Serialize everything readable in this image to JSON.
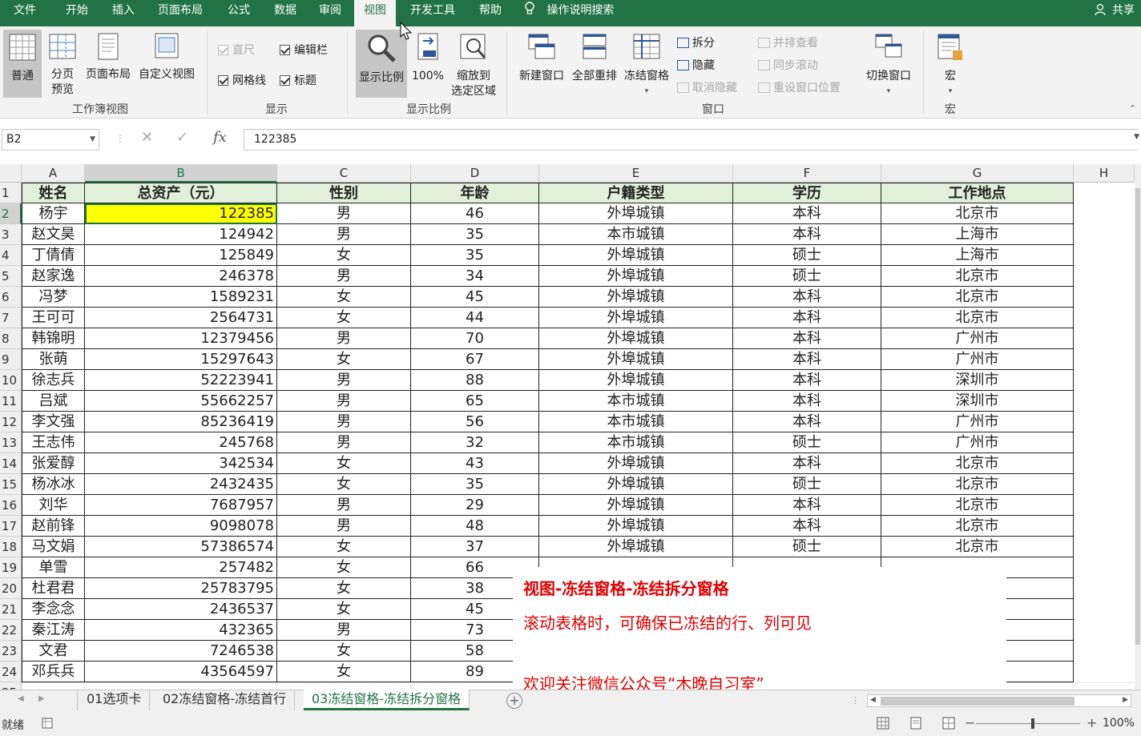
{
  "ribbon_tabs": [
    "文件",
    "开始",
    "插入",
    "页面布局",
    "公式",
    "数据",
    "审阅",
    "视图",
    "开发工具",
    "帮助"
  ],
  "active_tab": "视图",
  "tell_me": "操作说明搜索",
  "share": "共享",
  "ribbon": {
    "workbook_views": {
      "label": "工作簿视图",
      "normal": "普通",
      "page_break_1": "分页",
      "page_break_2": "预览",
      "page_layout": "页面布局",
      "custom_views": "自定义视图"
    },
    "show": {
      "label": "显示",
      "ruler": "直尺",
      "formula_bar": "编辑栏",
      "gridlines": "网格线",
      "headings": "标题"
    },
    "zoom": {
      "label": "显示比例",
      "zoom": "显示比例",
      "hundred": "100%",
      "zoom_sel_1": "缩放到",
      "zoom_sel_2": "选定区域"
    },
    "window": {
      "label": "窗口",
      "new_window": "新建窗口",
      "arrange_all": "全部重排",
      "freeze_panes": "冻结窗格",
      "split": "拆分",
      "hide": "隐藏",
      "unhide": "取消隐藏",
      "side_by_side": "并排查看",
      "sync_scroll": "同步滚动",
      "reset_pos": "重设窗口位置",
      "switch_windows": "切换窗口"
    },
    "macros": {
      "label": "宏",
      "macros": "宏"
    }
  },
  "formula_bar": {
    "name_box": "B2",
    "value": "122385"
  },
  "columns": [
    "A",
    "B",
    "C",
    "D",
    "E",
    "F",
    "G",
    "H"
  ],
  "header_row": [
    "姓名",
    "总资产（元）",
    "性别",
    "年龄",
    "户籍类型",
    "学历",
    "工作地点"
  ],
  "rows": [
    [
      "杨宇",
      "122385",
      "男",
      "46",
      "外埠城镇",
      "本科",
      "北京市"
    ],
    [
      "赵文昊",
      "124942",
      "男",
      "35",
      "本市城镇",
      "本科",
      "上海市"
    ],
    [
      "丁倩倩",
      "125849",
      "女",
      "35",
      "外埠城镇",
      "硕士",
      "上海市"
    ],
    [
      "赵家逸",
      "246378",
      "男",
      "34",
      "外埠城镇",
      "硕士",
      "北京市"
    ],
    [
      "冯梦",
      "1589231",
      "女",
      "45",
      "外埠城镇",
      "本科",
      "北京市"
    ],
    [
      "王可可",
      "2564731",
      "女",
      "44",
      "外埠城镇",
      "本科",
      "北京市"
    ],
    [
      "韩锦明",
      "12379456",
      "男",
      "70",
      "外埠城镇",
      "本科",
      "广州市"
    ],
    [
      "张萌",
      "15297643",
      "女",
      "67",
      "外埠城镇",
      "本科",
      "广州市"
    ],
    [
      "徐志兵",
      "52223941",
      "男",
      "88",
      "外埠城镇",
      "本科",
      "深圳市"
    ],
    [
      "吕斌",
      "55662257",
      "男",
      "65",
      "本市城镇",
      "本科",
      "深圳市"
    ],
    [
      "李文强",
      "85236419",
      "男",
      "56",
      "本市城镇",
      "本科",
      "广州市"
    ],
    [
      "王志伟",
      "245768",
      "男",
      "32",
      "本市城镇",
      "硕士",
      "广州市"
    ],
    [
      "张爱醇",
      "342534",
      "女",
      "43",
      "外埠城镇",
      "本科",
      "北京市"
    ],
    [
      "杨冰冰",
      "2432435",
      "女",
      "35",
      "外埠城镇",
      "硕士",
      "北京市"
    ],
    [
      "刘华",
      "7687957",
      "男",
      "29",
      "外埠城镇",
      "本科",
      "北京市"
    ],
    [
      "赵前锋",
      "9098078",
      "男",
      "48",
      "外埠城镇",
      "本科",
      "北京市"
    ],
    [
      "马文娟",
      "57386574",
      "女",
      "37",
      "外埠城镇",
      "硕士",
      "北京市"
    ],
    [
      "单雪",
      "257482",
      "女",
      "66",
      "",
      "",
      ""
    ],
    [
      "杜君君",
      "25783795",
      "女",
      "38",
      "",
      "",
      ""
    ],
    [
      "李念念",
      "2436537",
      "女",
      "45",
      "",
      "",
      ""
    ],
    [
      "秦江涛",
      "432365",
      "男",
      "73",
      "",
      "",
      ""
    ],
    [
      "文君",
      "7246538",
      "女",
      "58",
      "",
      "",
      ""
    ],
    [
      "邓兵兵",
      "43564597",
      "女",
      "89",
      "",
      "",
      ""
    ]
  ],
  "overlay": {
    "title": "视图-冻结窗格-冻结拆分窗格",
    "line1": "滚动表格时，可确保已冻结的行、列可见",
    "line2": "欢迎关注微信公众号“木晚自习室”"
  },
  "sheet_tabs": [
    "01选项卡",
    "02冻结窗格-冻结首行",
    "03冻结窗格-冻结拆分窗格"
  ],
  "active_sheet": "03冻结窗格-冻结拆分窗格",
  "status": {
    "ready": "就绪",
    "zoom": "100%"
  },
  "colors": {
    "accent": "#217346",
    "header_fill": "#e2efda",
    "highlight": "#ffff00",
    "overlay_text": "#e00000"
  }
}
